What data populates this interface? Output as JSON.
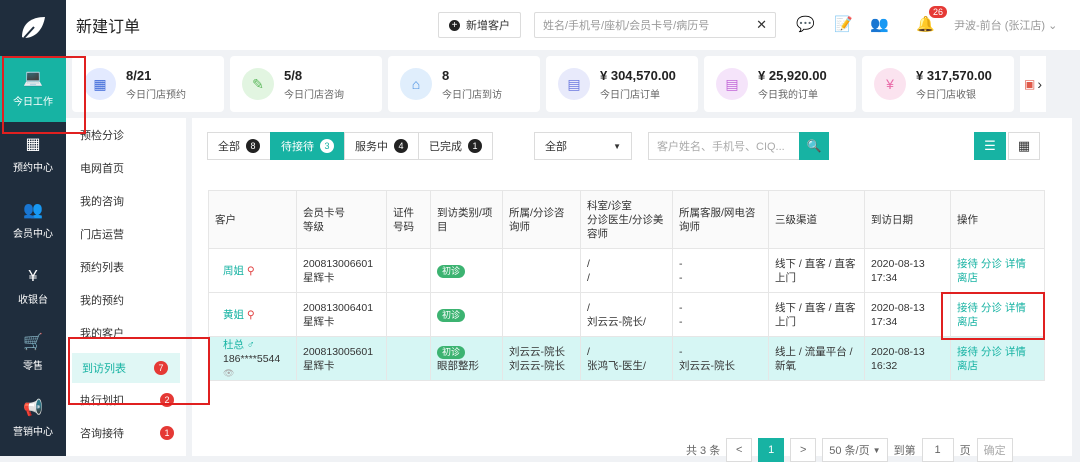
{
  "nav": {
    "items": [
      {
        "label": "今日工作",
        "icon": "laptop-icon"
      },
      {
        "label": "预约中心",
        "icon": "calendar-icon"
      },
      {
        "label": "会员中心",
        "icon": "users-icon"
      },
      {
        "label": "收银台",
        "icon": "yen-icon"
      },
      {
        "label": "零售",
        "icon": "cart-icon"
      },
      {
        "label": "营销中心",
        "icon": "megaphone-icon"
      }
    ]
  },
  "header": {
    "title": "新建订单",
    "new_customer": "新增客户",
    "search_placeholder": "姓名/手机号/座机/会员卡号/病历号",
    "notif_count": "26",
    "user": "尹波-前台 (张江店)"
  },
  "stats": [
    {
      "value": "8/21",
      "label": "今日门店预约",
      "color": "#3f6ad8"
    },
    {
      "value": "5/8",
      "label": "今日门店咨询",
      "color": "#5cb85c"
    },
    {
      "value": "8",
      "label": "今日门店到访",
      "color": "#4a90e2"
    },
    {
      "value": "¥ 304,570.00",
      "label": "今日门店订单",
      "color": "#6c7ae0"
    },
    {
      "value": "¥ 25,920.00",
      "label": "今日我的订单",
      "color": "#c266d8"
    },
    {
      "value": "¥ 317,570.00",
      "label": "今日门店收银",
      "color": "#e96aa8"
    }
  ],
  "sidebar": {
    "items": [
      {
        "label": "预检分诊"
      },
      {
        "label": "电网首页"
      },
      {
        "label": "我的咨询"
      },
      {
        "label": "门店运营"
      },
      {
        "label": "预约列表"
      },
      {
        "label": "我的预约"
      },
      {
        "label": "我的客户"
      },
      {
        "label": "到访列表",
        "count": "7"
      },
      {
        "label": "执行划扣",
        "count": "2"
      },
      {
        "label": "咨询接待",
        "count": "1"
      }
    ]
  },
  "filters": {
    "tabs": [
      {
        "label": "全部",
        "count": "8"
      },
      {
        "label": "待接待",
        "count": "3"
      },
      {
        "label": "服务中",
        "count": "4"
      },
      {
        "label": "已完成",
        "count": "1"
      }
    ],
    "select_value": "全部",
    "keyword_placeholder": "客户姓名、手机号、CIQ..."
  },
  "table": {
    "headers": [
      "客户",
      "会员卡号\n等级",
      "证件号码",
      "到访类别/项目",
      "所属/分诊咨询师",
      "科室/诊室\n分诊医生/分诊美容师",
      "所属客服/网电咨询师",
      "三级渠道",
      "到访日期",
      "操作"
    ],
    "rows": [
      {
        "name": "周姐",
        "phone": "",
        "card": "200813006601",
        "level": "星辉卡",
        "visit_tag": "初诊",
        "visit_item": "",
        "consult1": "",
        "consult2": "",
        "dept1": "/",
        "dept2": "/",
        "service1": "-",
        "service2": "-",
        "channel": "线下 / 直客 / 直客上门",
        "date": "2020-08-13",
        "time": "17:34",
        "ops": "接待 分诊 详情",
        "ops2": "离店"
      },
      {
        "name": "黄姐",
        "phone": "",
        "card": "200813006401",
        "level": "星辉卡",
        "visit_tag": "初诊",
        "visit_item": "",
        "consult1": "",
        "consult2": "",
        "dept1": "/",
        "dept2": "刘云云-院长/",
        "service1": "-",
        "service2": "-",
        "channel": "线下 / 直客 / 直客上门",
        "date": "2020-08-13",
        "time": "17:34",
        "ops": "接待 分诊 详情",
        "ops2": "离店"
      },
      {
        "name": "杜总",
        "phone": "186****5544",
        "card": "200813005601",
        "level": "星辉卡",
        "visit_tag": "初诊",
        "visit_item": "眼部整形",
        "consult1": "刘云云-院长",
        "consult2": "刘云云-院长",
        "dept1": "/",
        "dept2": "张鸿飞-医生/",
        "service1": "-",
        "service2": "刘云云-院长",
        "channel": "线上 / 流量平台 / 新氧",
        "date": "2020-08-13",
        "time": "16:32",
        "ops": "接待 分诊 详情",
        "ops2": "离店"
      }
    ]
  },
  "pagination": {
    "total": "共 3 条",
    "prev": "<",
    "current": "1",
    "next": ">",
    "page_size": "50 条/页",
    "goto_label": "到第",
    "goto_value": "1",
    "page_unit": "页",
    "confirm": "确定"
  }
}
